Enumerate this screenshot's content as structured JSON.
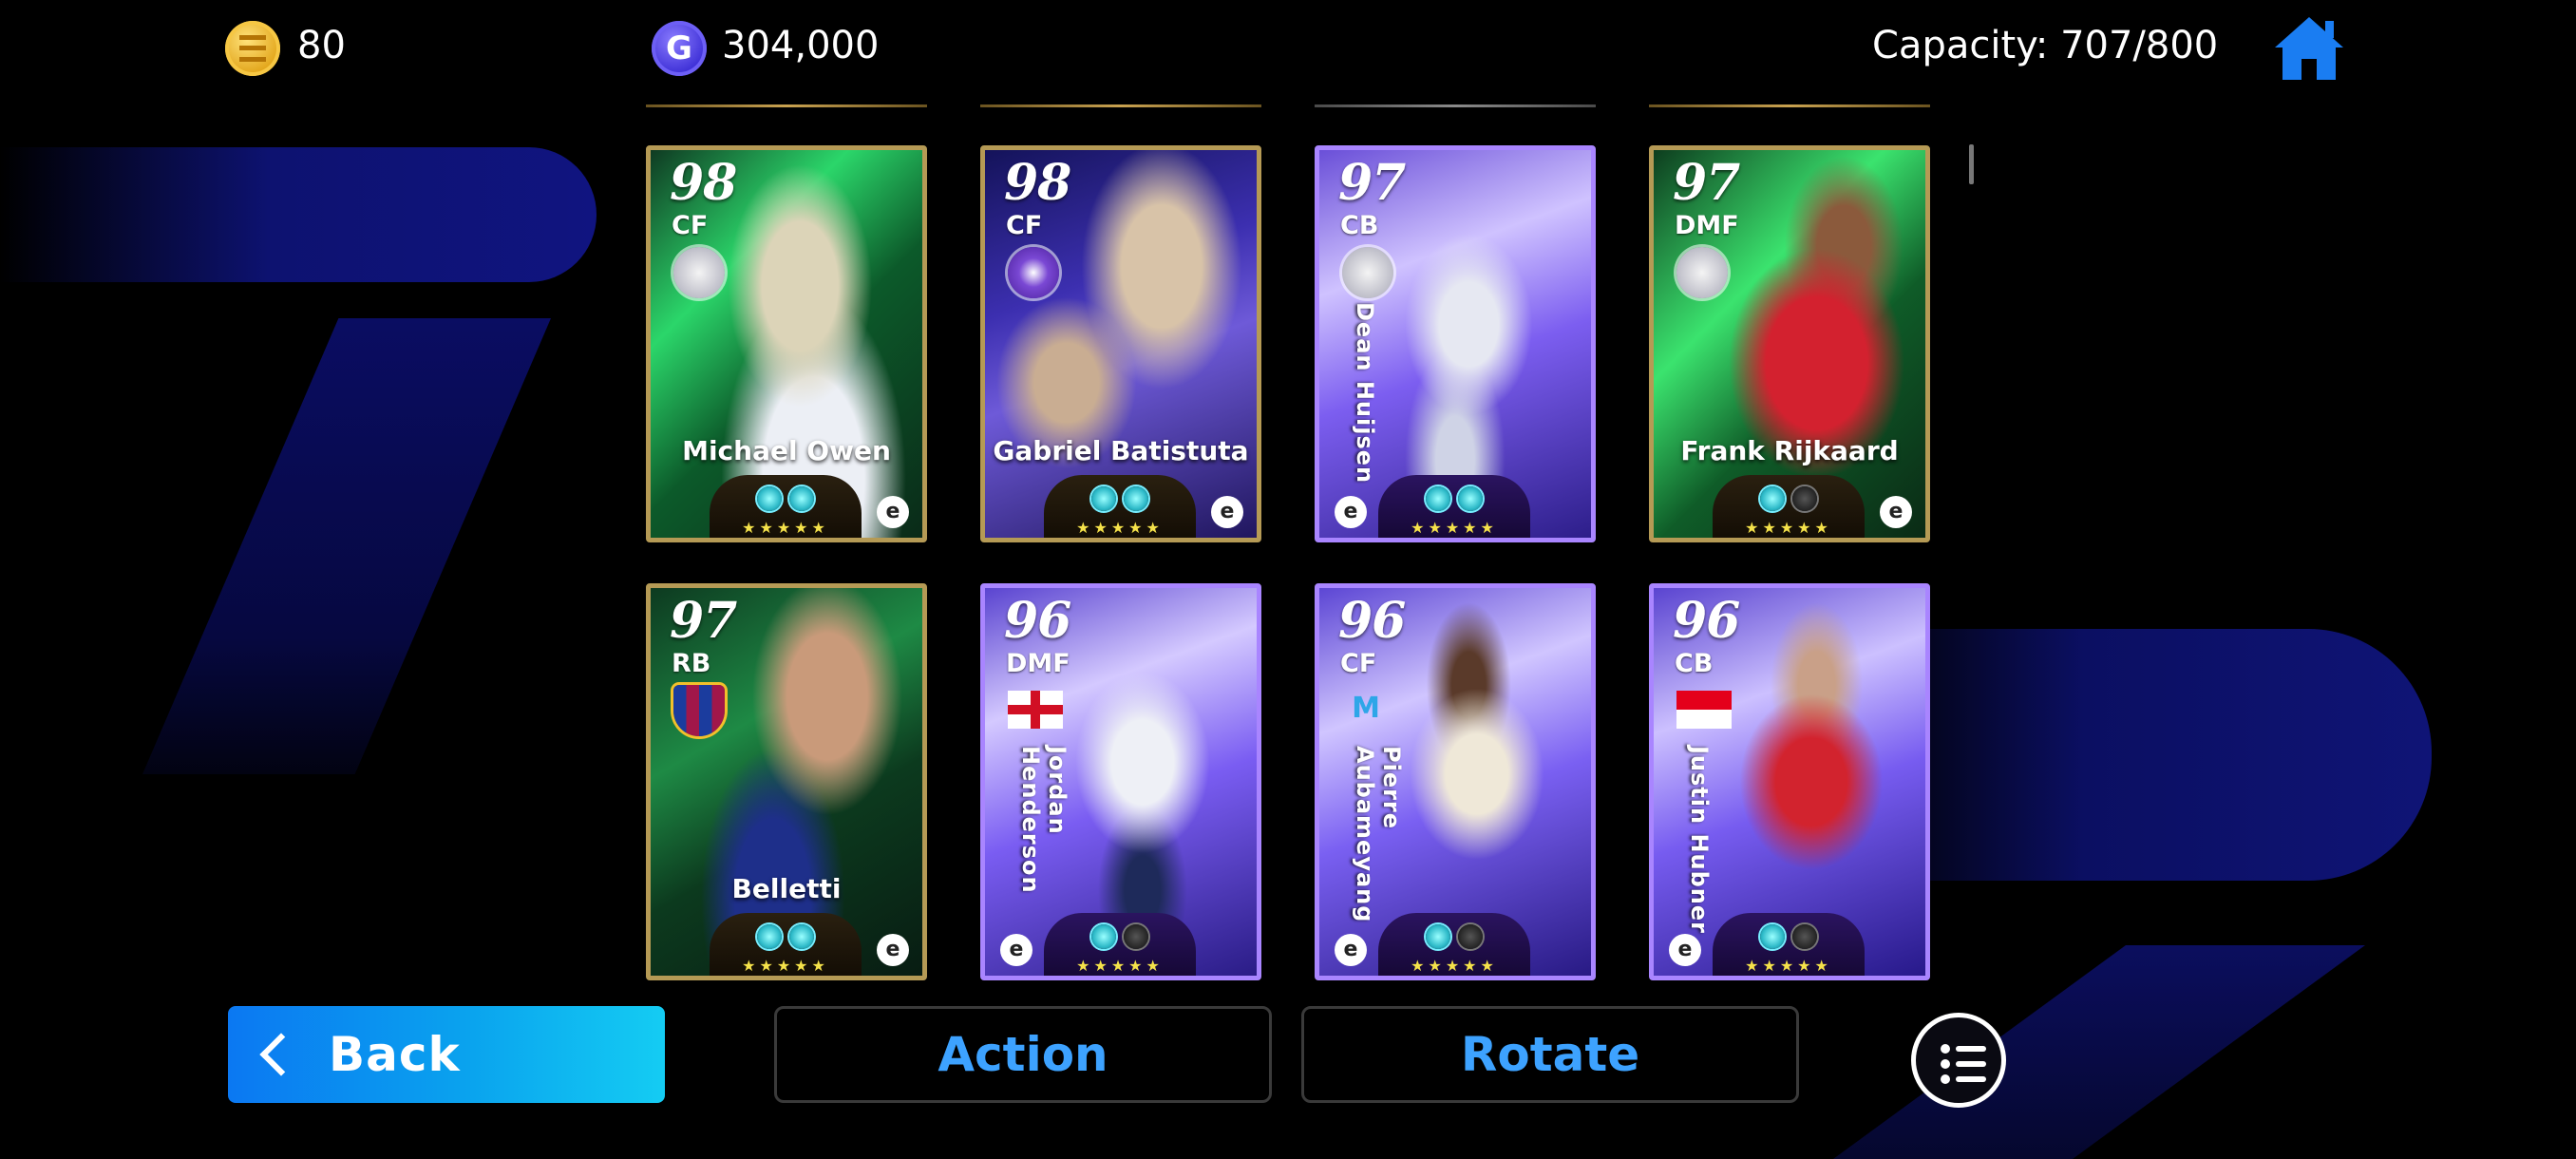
{
  "currency": {
    "coins": "80",
    "gp": "304,000",
    "gp_symbol": "G"
  },
  "capacity": "Capacity: 707/800",
  "cards": [
    {
      "rating": "98",
      "position": "CF",
      "name": "Michael Owen",
      "name_style": "horizontal",
      "frame": "gold",
      "stars": "★★★★★",
      "crest": "club-crest"
    },
    {
      "rating": "98",
      "position": "CF",
      "name": "Gabriel Batistuta",
      "name_style": "horizontal",
      "frame": "gold",
      "stars": "★★★★★",
      "crest": "club-crest"
    },
    {
      "rating": "97",
      "position": "CB",
      "name": "Dean Huijsen",
      "name_style": "vertical",
      "frame": "purple",
      "stars": "★★★★★",
      "crest": "club-crest"
    },
    {
      "rating": "97",
      "position": "DMF",
      "name": "Frank Rijkaard",
      "name_style": "horizontal",
      "frame": "gold",
      "stars": "★★★★★",
      "crest": "club-crest"
    },
    {
      "rating": "97",
      "position": "RB",
      "name": "Belletti",
      "name_style": "horizontal",
      "frame": "gold",
      "stars": "★★★★★",
      "crest": "club-crest"
    },
    {
      "rating": "96",
      "position": "DMF",
      "name": "Jordan Henderson",
      "name_style": "vertical",
      "frame": "purple",
      "stars": "★★★★★",
      "crest": "flag-england"
    },
    {
      "rating": "96",
      "position": "CF",
      "name": "Pierre Aubameyang",
      "name_style": "vertical",
      "frame": "purple",
      "stars": "★★★★★",
      "crest": "club-crest"
    },
    {
      "rating": "96",
      "position": "CB",
      "name": "Justin Hubner",
      "name_style": "vertical",
      "frame": "purple",
      "stars": "★★★★★",
      "crest": "flag-indonesia"
    }
  ],
  "buttons": {
    "back": "Back",
    "action": "Action",
    "rotate": "Rotate"
  },
  "icons": {
    "coin": "coin-icon",
    "gp": "gp-icon",
    "home": "home-icon",
    "list": "list-menu-icon",
    "back": "chevron-left-icon"
  },
  "colors": {
    "accent_blue": "#0a8ff0",
    "action_text": "#3da2ff",
    "gold_frame": "#b59a55",
    "purple_frame": "#a985ff"
  }
}
